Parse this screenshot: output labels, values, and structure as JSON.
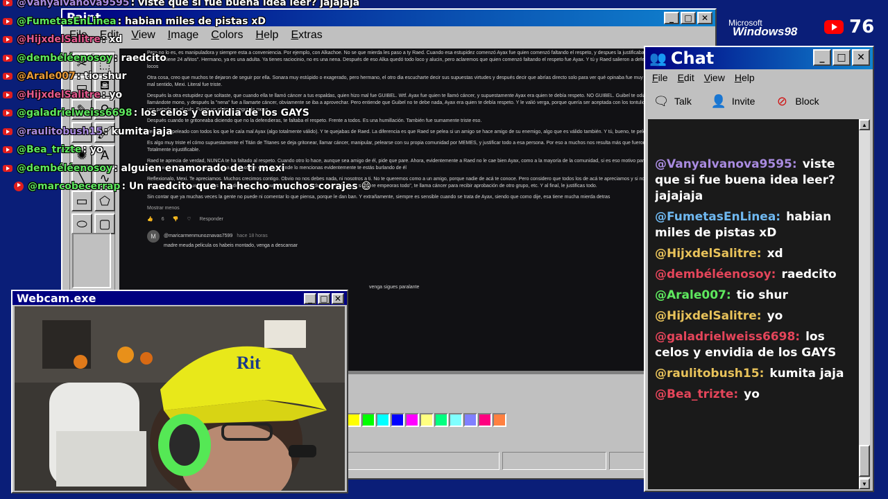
{
  "paint": {
    "title": "Paint",
    "menu": [
      "File",
      "Edit",
      "View",
      "Image",
      "Colors",
      "Help",
      "Extras"
    ],
    "canvas_paragraphs": [
      "Pero no lo es, es manipuladora y siempre esta a conveniencia. Por ejemplo, con Alkachoe. No se que mierda les paso a ty Raed. Cuando esa estupidez comenzó Ayax fue quien comenzó faltando el respeto, y despues la justificabas diciendo que ella podia porque \"tiene 24 añitos\". Hermano, ya es una adulta. Ya tienes raciocinio, no es una nena. Después de eso Alka quedó todo loco y alucin, pero aclaremos que quien comenzó faltando el respeto fue Ayax. Y tú y Raed salieron a defenderla y justificarla como locos",
      "Otra cosa, creo que muchos te dejaron de seguir por ella. Sonara muy estúpido o exagerado, pero hermano, el otro dia escucharte decir sus supuestas virtudes y después decir que abrías directo solo para ver qué opinaba fue muy triste, y no lo digo en el mal sentido, Mexi. Literal fue triste.",
      "Después la otra estupidez que soltaste, que cuando ella te llamó cáncer a tus espaldas, quien hizo mal fue GUIBEL. Wtf. Ayax fue quien te llamó cáncer, y supuestamente Ayax era quien te debía respeto. NO GUIBEL. Guibel te odiaba y se burlaba de ti llamándote mono, y después la \"nena\" fue a llamarte cáncer, obviamente se iba a aprovechar. Pero entiende que Guibel no te debe nada, Ayax era quien te debía respeto. Y le valió verga, porque quería ser aceptada con los tontulios pero al final le dieron una patada en el culo. Fuiste un plato de segunda mesa",
      "Después cuando te gritoneaba diciendo que no la defendieras, te faltaba el respeto. Frente a todos. Es una humillación. También fue sumamente triste eso.",
      "Terminaste peleado con todos los que le caía mal Ayax (algo totalmente válido). Y te quejabas de Raed. La diferencia es que Raed se pelea si un amigo se hace amigo de su enemigo, algo que es válido también. Y tú, bueno, te peleaste con todos.",
      "Es algo muy triste el cómo supuestamente el Titán de Titanes se deja gritonear, llamar cáncer, manipular, pelearse con su propia comunidad por MEMES, y justificar todo a esa persona. Por eso a muchos nos resulta más que fueron celos entre mujeres y ya. Totalmente injustificable.",
      "Raed te aprecia de verdad, NUNCA te ha faltado al respeto. Cuando otro lo hace, aunque sea amigo de él, pide que pare. Ahora, evidentemente a Raed no le cae bien Ayax, como a la mayoría de la comunidad, si es eso motivo para que te pelees con él, bueno xd. Lo digo en caso de que sea bait, porque esa parte donde lo mencionas evidentemente te estás burlando de él",
      "Reflexionalo, Mexi. Te apreciamos. Muchos crecimos contigo. Obvio no nos debes nada, ni nosotros a ti. No te queremos como a un amigo, porque nadie de acá te conoce. Pero considero que todos los de acá te apreciamos y si nos resulta incómodo el cómo alguien hace que te pelees con todo mundo y después te humilla diciendo \"yo no te lo pedí, siempre empeoras todo\", te llama cáncer para recibir aprobación de otro grupo, etc. Y al final, le justificas todo.",
      "Sin contar que ya muchas veces la gente no puede ni comentar lo que piensa, porque le dan ban. Y extrañamente, siempre es sensible cuando se trata de Ayax, siendo que como dije, esa tiene mucha mierda detras"
    ],
    "show_less": "Mostrar menos",
    "reply": "Responder",
    "likes": "6",
    "reply_author": "@maricarmenmunoznavas7599",
    "reply_time": "hace 18 horas",
    "reply_text": "madre meuda pelicula os habeis montado, venga a descansar",
    "reply_tail": "venga sigues paralante",
    "avatar_letter": "M",
    "palette": [
      "#ffff00",
      "#00ff00",
      "#00ffff",
      "#0000ff",
      "#ff00ff",
      "#ffff80",
      "#00ff80",
      "#80ffff",
      "#8080ff",
      "#ff0080",
      "#ff8040"
    ]
  },
  "overlay_chat": [
    {
      "user": "@Vanyaivanova9595",
      "msg": ": viste que si fue buena idea leer? jajajaja",
      "color": "#a98be0",
      "icon": "yt"
    },
    {
      "user": "@FumetasEnLinea",
      "msg": ": habian miles de pistas xD",
      "color": "#5ee85e",
      "icon": "yt"
    },
    {
      "user": "@HijxdelSalitre",
      "msg": ": xd",
      "color": "#e45a8f",
      "icon": "yt"
    },
    {
      "user": "@dembéléenosoy",
      "msg": ": raedcito",
      "color": "#5ee85e",
      "icon": "yt"
    },
    {
      "user": "@Arale007",
      "msg": ": tio shur",
      "color": "#e89a3a",
      "icon": "yt"
    },
    {
      "user": "@HijxdelSalitre",
      "msg": ": yo",
      "color": "#e45a8f",
      "icon": "yt"
    },
    {
      "user": "@galadrielweiss6698",
      "msg": ": los celos y envidia de los GAYS",
      "color": "#5ee85e",
      "icon": "yt"
    },
    {
      "user": "@raulitobush15",
      "msg": ": kumita jaja",
      "color": "#a98be0",
      "icon": "yt"
    },
    {
      "user": "@Bea_trizte",
      "msg": ": yo",
      "color": "#5ee85e",
      "icon": "yt"
    },
    {
      "user": "@dembéléenosoy",
      "msg": ": alguien enamorado de ti mexi",
      "color": "#5ee85e",
      "icon": "yt"
    },
    {
      "user": "@marcobecerrap",
      "msg": ": Un raedcito que ha hecho muchos corajes 😄",
      "color": "#5ee85e",
      "icon": "star"
    }
  ],
  "webcam": {
    "title": "Webcam.exe"
  },
  "branding": {
    "microsoft": "Microsoft",
    "windows98": "Windows98"
  },
  "yt_counter": {
    "value": "76"
  },
  "chat": {
    "title": "Chat",
    "menu": [
      "File",
      "Edit",
      "View",
      "Help"
    ],
    "toolbar": [
      {
        "label": "Talk",
        "icon": "talk-icon"
      },
      {
        "label": "Invite",
        "icon": "invite-icon"
      },
      {
        "label": "Block",
        "icon": "block-icon"
      }
    ],
    "messages": [
      {
        "user": "@VanyaIvanova9595:",
        "msg": "viste que si fue buena idea leer? jajajaja",
        "color": "#a98be0"
      },
      {
        "user": "@FumetasEnLinea:",
        "msg": "habian miles de pistas xD",
        "color": "#6fb8f0"
      },
      {
        "user": "@HijxdelSalitre:",
        "msg": "xd",
        "color": "#e8c25a"
      },
      {
        "user": "@dembéléenosoy:",
        "msg": "raedcito",
        "color": "#e4455a"
      },
      {
        "user": "@Arale007:",
        "msg": "tio shur",
        "color": "#5ee85e"
      },
      {
        "user": "@HijxdelSalitre:",
        "msg": "yo",
        "color": "#e8c25a"
      },
      {
        "user": "@galadrielweiss6698:",
        "msg": "los celos y envidia de los GAYS",
        "color": "#e4455a"
      },
      {
        "user": "@raulitobush15:",
        "msg": "kumita jaja",
        "color": "#e8c25a"
      },
      {
        "user": "@Bea_trizte:",
        "msg": "yo",
        "color": "#e4455a"
      }
    ]
  }
}
